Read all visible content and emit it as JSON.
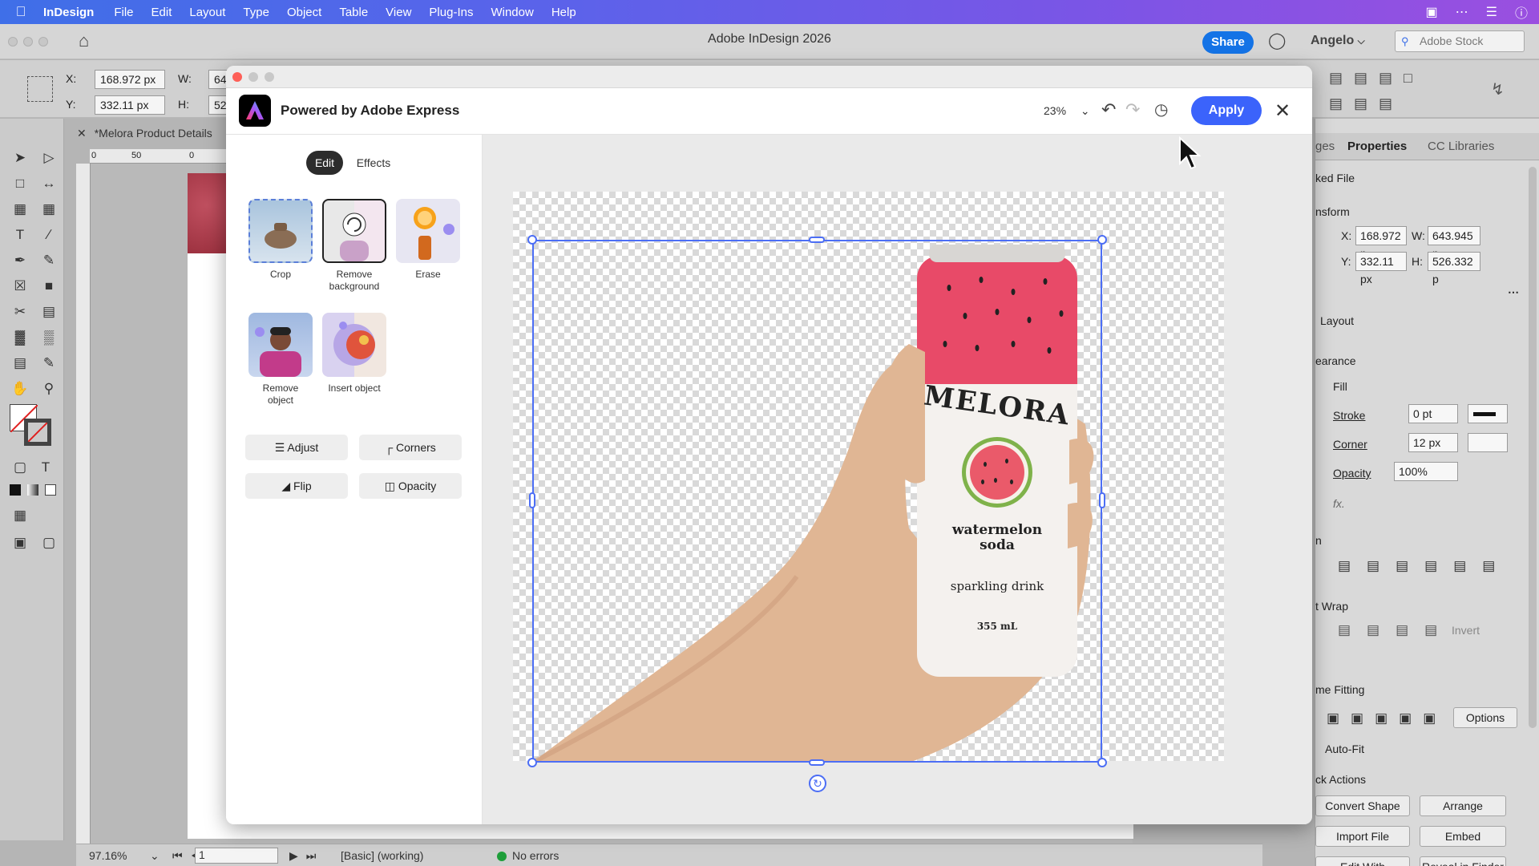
{
  "menubar": {
    "app_name": "InDesign",
    "items": [
      "File",
      "Edit",
      "Layout",
      "Type",
      "Object",
      "Table",
      "View",
      "Plug-Ins",
      "Window",
      "Help"
    ]
  },
  "titlebar": {
    "title": "Adobe InDesign 2026",
    "share_label": "Share",
    "user_name": "Angelo",
    "stock_placeholder": "Adobe Stock"
  },
  "controlbar": {
    "x_label": "X:",
    "y_label": "Y:",
    "w_label": "W:",
    "h_label": "H:",
    "x_value": "168.972 px",
    "y_value": "332.11 px",
    "w_value": "64",
    "h_value": "52"
  },
  "document": {
    "tab_title": "*Melora Product Details",
    "ruler_marks": [
      "0",
      "50",
      "0"
    ]
  },
  "statusbar": {
    "zoom": "97.16%",
    "page": "1",
    "profile": "[Basic] (working)",
    "errors": "No errors"
  },
  "properties": {
    "tabs": [
      "ges",
      "Properties",
      "CC Libraries"
    ],
    "linked_file_label": "ked File",
    "transform_label": "nsform",
    "x_label": "X:",
    "y_label": "Y:",
    "w_label": "W:",
    "h_label": "H:",
    "x_value": "168.972 p",
    "y_value": "332.11 px",
    "w_value": "643.945 p",
    "h_value": "526.332 p",
    "layout_label": "Layout",
    "appearance_label": "earance",
    "fill_label": "Fill",
    "stroke_label": "Stroke",
    "stroke_value": "0 pt",
    "corner_label": "Corner",
    "corner_value": "12 px",
    "opacity_label": "Opacity",
    "opacity_value": "100%",
    "fx_label": "fx.",
    "align_label": "n",
    "wrap_label": "t Wrap",
    "invert_label": "Invert",
    "fitting_label": "me Fitting",
    "options_label": "Options",
    "autofit_label": "Auto-Fit",
    "quick_actions_label": "ck Actions",
    "convert_shape": "Convert Shape",
    "arrange": "Arrange",
    "import_file": "Import File",
    "embed": "Embed",
    "edit_with": "Edit With",
    "reveal_in_finder": "Reveal in Finder"
  },
  "modal": {
    "title": "Powered by Adobe Express",
    "zoom": "23%",
    "apply_label": "Apply",
    "tabs": {
      "edit": "Edit",
      "effects": "Effects"
    },
    "quick_actions": [
      {
        "label": "Crop"
      },
      {
        "label": "Remove background"
      },
      {
        "label": "Erase"
      },
      {
        "label": "Remove object"
      },
      {
        "label": "Insert object"
      }
    ],
    "buttons": {
      "adjust": "Adjust",
      "corners": "Corners",
      "flip": "Flip",
      "opacity": "Opacity"
    }
  },
  "can": {
    "brand": "MELORA",
    "flavor_line1": "watermelon",
    "flavor_line2": "soda",
    "tagline": "sparkling drink",
    "volume": "355 mL"
  },
  "colors": {
    "menubar_start": "#3f6fe8",
    "menubar_end": "#9a4fe0",
    "accent": "#3b63fb",
    "share": "#1473e6",
    "can_top": "#e84a68",
    "selection": "#4c6ef5"
  }
}
